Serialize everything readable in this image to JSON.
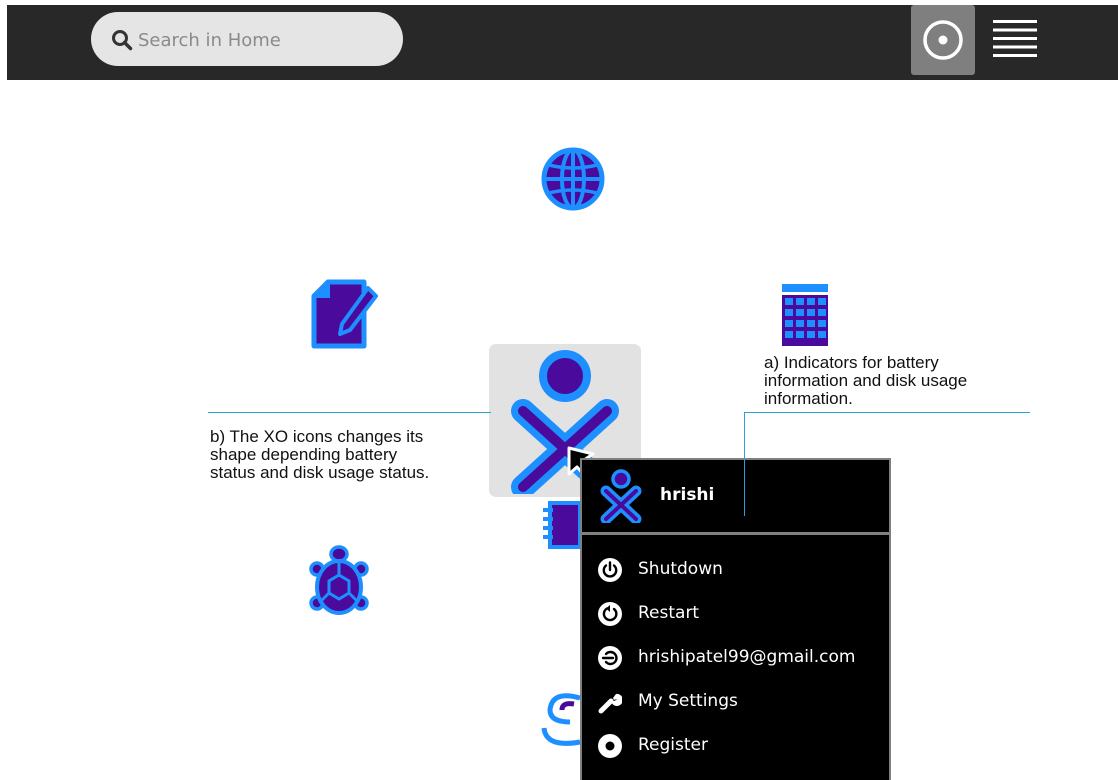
{
  "toolbar": {
    "search_placeholder": "Search in Home",
    "icons": [
      "search-icon",
      "home-view-icon",
      "list-view-icon"
    ]
  },
  "home": {
    "activity_icons": [
      "browse-icon",
      "write-icon",
      "calculate-icon",
      "turtle-art-icon",
      "journal-icon",
      "speak-icon",
      "xo-icon"
    ],
    "annotation_b": [
      "b) The XO icons changes its",
      "shape depending battery",
      "status and disk usage status."
    ],
    "annotation_a": [
      "a) Indicators for battery",
      "information and disk usage",
      "information."
    ]
  },
  "palette": {
    "username": "hrishi",
    "items": [
      {
        "label": "Shutdown",
        "icon": "shutdown-icon"
      },
      {
        "label": "Restart",
        "icon": "restart-icon"
      },
      {
        "label": "hrishipatel99@gmail.com",
        "icon": "logout-icon"
      },
      {
        "label": "My Settings",
        "icon": "settings-icon"
      },
      {
        "label": "Register",
        "icon": "register-icon"
      }
    ]
  },
  "colors": {
    "toolbar_bg": "#282828",
    "icon_fill": "#4a0a9c",
    "icon_stroke": "#1e8fff",
    "annotation_line": "#2aa0d8",
    "palette_bg": "#000000"
  }
}
